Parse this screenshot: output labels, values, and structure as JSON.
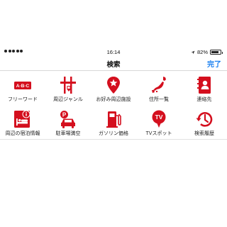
{
  "status_bar": {
    "time": "16:14",
    "battery_percent": "82%",
    "battery_level": 0.82,
    "location_icon": "location-arrow-icon",
    "signal_icon": "signal-dots-icon"
  },
  "nav": {
    "title": "検索",
    "done_label": "完了"
  },
  "accent_color": "#d40f1e",
  "link_color": "#1a7ff0",
  "tiles": [
    {
      "label": "フリーワード",
      "icon": "abc-keyboard-icon"
    },
    {
      "label": "周辺ジャンル",
      "icon": "intersection-pin-icon"
    },
    {
      "label": "お好み周辺施設",
      "icon": "star-pin-icon"
    },
    {
      "label": "住所一覧",
      "icon": "japan-map-icon"
    },
    {
      "label": "連絡先",
      "icon": "address-book-icon"
    },
    {
      "label": "周辺の宿泊情報",
      "icon": "hotel-bed-icon"
    },
    {
      "label": "駐車場満空",
      "icon": "parking-car-icon"
    },
    {
      "label": "ガソリン価格",
      "icon": "gas-pump-icon"
    },
    {
      "label": "TVスポット",
      "icon": "tv-pin-icon"
    },
    {
      "label": "検索履歴",
      "icon": "history-clock-icon"
    }
  ],
  "icon_text": {
    "abc": "A·B·C",
    "parking": "P",
    "tv": "TV"
  }
}
